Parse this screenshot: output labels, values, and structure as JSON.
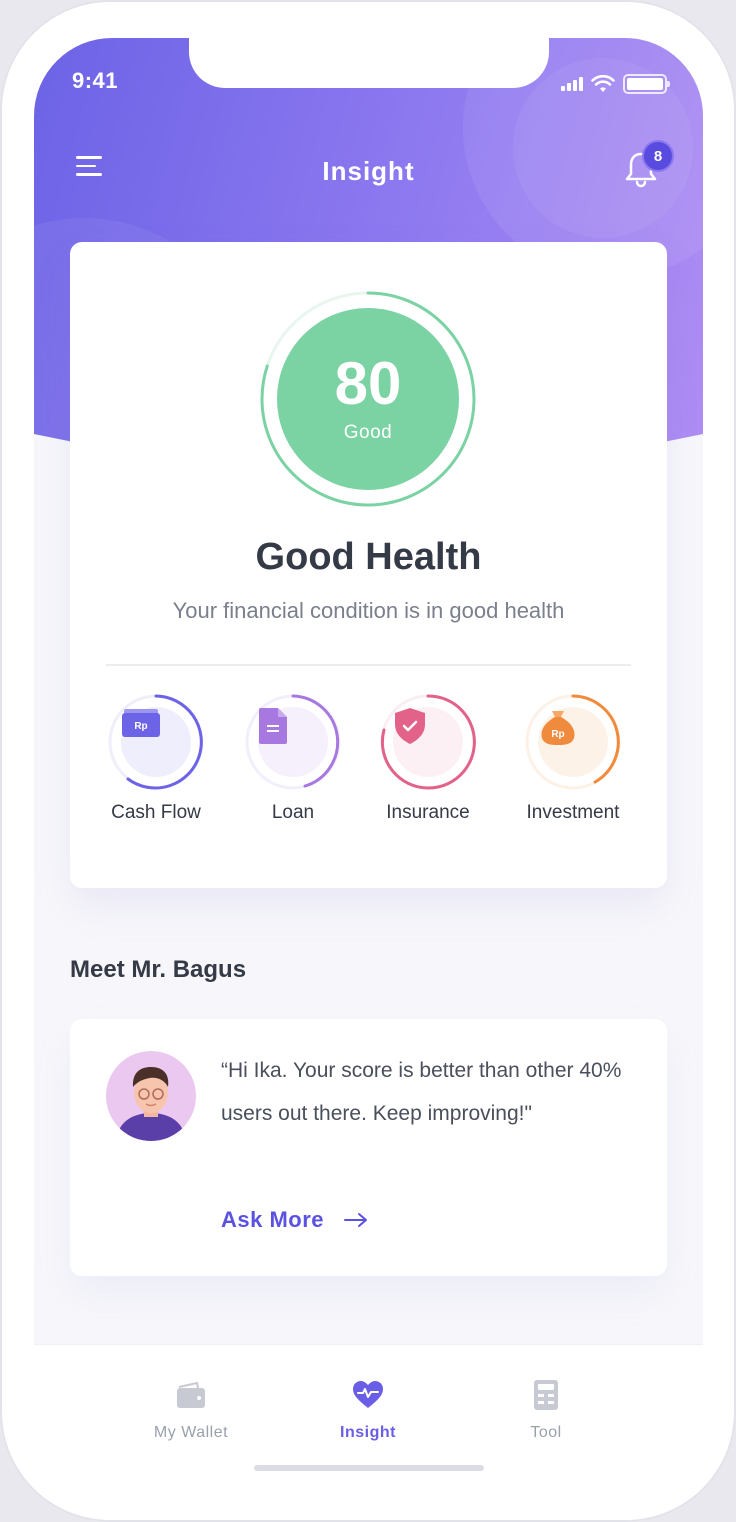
{
  "status_bar": {
    "time": "9:41"
  },
  "header": {
    "title": "Insight",
    "notification_count": "8"
  },
  "health": {
    "score": "80",
    "score_label": "Good",
    "score_fraction": 0.8,
    "title": "Good Health",
    "subtitle": "Your financial condition is in good health",
    "color": "#7bd3a4"
  },
  "categories": [
    {
      "label": "Cash Flow",
      "icon": "wallet-rp-icon",
      "color": "#6c63e6",
      "icon_text": "Rp"
    },
    {
      "label": "Loan",
      "icon": "document-icon",
      "color": "#a678e0"
    },
    {
      "label": "Insurance",
      "icon": "shield-check-icon",
      "color": "#e2628a"
    },
    {
      "label": "Investment",
      "icon": "money-bag-icon",
      "color": "#f08a3c",
      "icon_text": "Rp"
    }
  ],
  "advisor": {
    "section_title": "Meet Mr. Bagus",
    "quote": "“Hi Ika. Your score is better than other 40% users out there. Keep improving!\"",
    "cta": "Ask More"
  },
  "tabbar": {
    "tabs": [
      {
        "label": "My Wallet",
        "icon": "wallet-icon",
        "active": false
      },
      {
        "label": "Insight",
        "icon": "heart-pulse-icon",
        "active": true
      },
      {
        "label": "Tool",
        "icon": "calculator-icon",
        "active": false
      }
    ]
  },
  "colors": {
    "accent": "#6a5ee6",
    "header_gradient_start": "#6c63e6",
    "header_gradient_end": "#b08ef4"
  }
}
